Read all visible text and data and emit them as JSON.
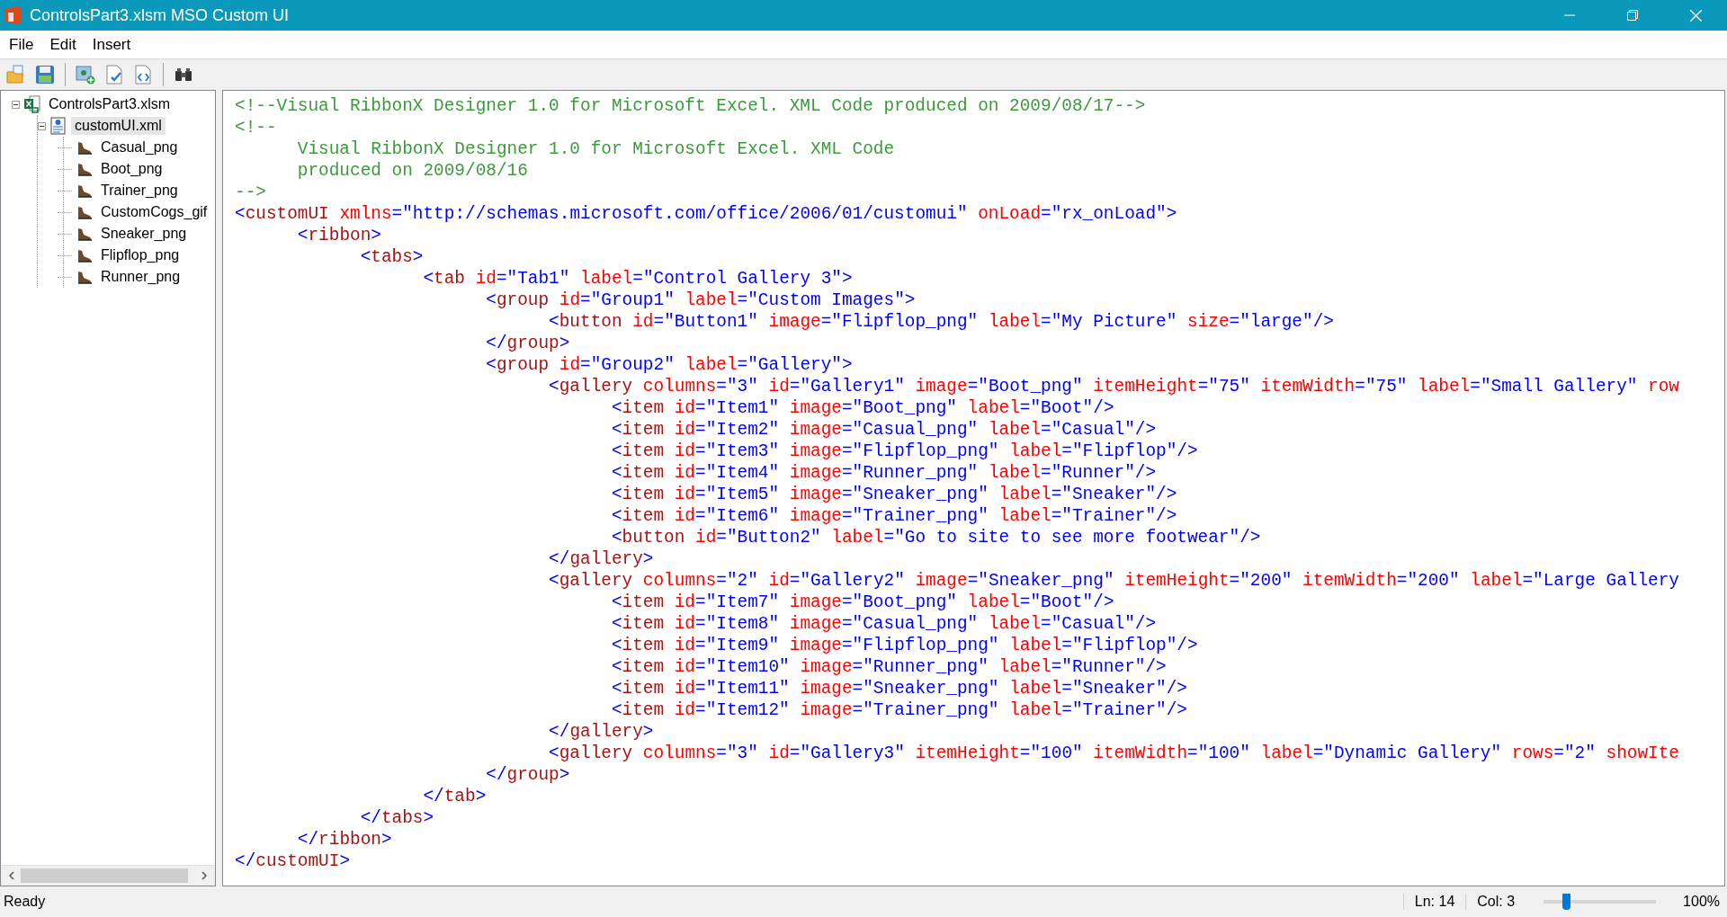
{
  "window": {
    "title": "ControlsPart3.xlsm MSO Custom UI"
  },
  "menu": [
    "File",
    "Edit",
    "Insert"
  ],
  "toolbar": [
    {
      "kind": "open"
    },
    {
      "kind": "save"
    },
    {
      "kind": "separator"
    },
    {
      "kind": "insert-image"
    },
    {
      "kind": "validate"
    },
    {
      "kind": "callbacks"
    },
    {
      "kind": "separator"
    },
    {
      "kind": "find"
    }
  ],
  "tree": [
    {
      "label": "ControlsPart3.xlsm",
      "kind": "workbook",
      "expanded": true,
      "selected": false,
      "children": [
        {
          "label": "customUI.xml",
          "kind": "xml",
          "expanded": true,
          "selected": true,
          "children": [
            {
              "label": "Casual_png",
              "kind": "image",
              "selected": false
            },
            {
              "label": "Boot_png",
              "kind": "image",
              "selected": false
            },
            {
              "label": "Trainer_png",
              "kind": "image",
              "selected": false
            },
            {
              "label": "CustomCogs_gif",
              "kind": "image",
              "selected": false
            },
            {
              "label": "Sneaker_png",
              "kind": "image",
              "selected": false
            },
            {
              "label": "Flipflop_png",
              "kind": "image",
              "selected": false
            },
            {
              "label": "Runner_png",
              "kind": "image",
              "selected": false
            }
          ]
        }
      ]
    }
  ],
  "code_lines": [
    {
      "kind": "comment",
      "text": "<!--Visual RibbonX Designer 1.0 for Microsoft Excel. XML Code produced on 2009/08/17-->"
    },
    {
      "kind": "comment",
      "text": "<!--"
    },
    {
      "kind": "comment",
      "text": "\tVisual RibbonX Designer 1.0 for Microsoft Excel. XML Code"
    },
    {
      "kind": "comment",
      "text": "\tproduced on 2009/08/16"
    },
    {
      "kind": "comment",
      "text": "-->"
    },
    {
      "kind": "markup",
      "text": "<customUI xmlns=\"http://schemas.microsoft.com/office/2006/01/customui\" onLoad=\"rx_onLoad\">"
    },
    {
      "kind": "markup",
      "text": "\t<ribbon>"
    },
    {
      "kind": "markup",
      "text": "\t\t<tabs>"
    },
    {
      "kind": "markup",
      "text": "\t\t\t<tab id=\"Tab1\" label=\"Control Gallery 3\">"
    },
    {
      "kind": "markup",
      "text": "\t\t\t\t<group id=\"Group1\" label=\"Custom Images\">"
    },
    {
      "kind": "markup",
      "text": "\t\t\t\t\t<button id=\"Button1\" image=\"Flipflop_png\" label=\"My Picture\" size=\"large\"/>"
    },
    {
      "kind": "markup",
      "text": "\t\t\t\t</group>"
    },
    {
      "kind": "markup",
      "text": "\t\t\t\t<group id=\"Group2\" label=\"Gallery\">"
    },
    {
      "kind": "markup",
      "text": "\t\t\t\t\t<gallery columns=\"3\" id=\"Gallery1\" image=\"Boot_png\" itemHeight=\"75\" itemWidth=\"75\" label=\"Small Gallery\" row"
    },
    {
      "kind": "markup",
      "text": "\t\t\t\t\t\t<item id=\"Item1\" image=\"Boot_png\" label=\"Boot\"/>"
    },
    {
      "kind": "markup",
      "text": "\t\t\t\t\t\t<item id=\"Item2\" image=\"Casual_png\" label=\"Casual\"/>"
    },
    {
      "kind": "markup",
      "text": "\t\t\t\t\t\t<item id=\"Item3\" image=\"Flipflop_png\" label=\"Flipflop\"/>"
    },
    {
      "kind": "markup",
      "text": "\t\t\t\t\t\t<item id=\"Item4\" image=\"Runner_png\" label=\"Runner\"/>"
    },
    {
      "kind": "markup",
      "text": "\t\t\t\t\t\t<item id=\"Item5\" image=\"Sneaker_png\" label=\"Sneaker\"/>"
    },
    {
      "kind": "markup",
      "text": "\t\t\t\t\t\t<item id=\"Item6\" image=\"Trainer_png\" label=\"Trainer\"/>"
    },
    {
      "kind": "markup",
      "text": "\t\t\t\t\t\t<button id=\"Button2\" label=\"Go to site to see more footwear\"/>"
    },
    {
      "kind": "markup",
      "text": "\t\t\t\t\t</gallery>"
    },
    {
      "kind": "markup",
      "text": "\t\t\t\t\t<gallery columns=\"2\" id=\"Gallery2\" image=\"Sneaker_png\" itemHeight=\"200\" itemWidth=\"200\" label=\"Large Gallery"
    },
    {
      "kind": "markup",
      "text": "\t\t\t\t\t\t<item id=\"Item7\" image=\"Boot_png\" label=\"Boot\"/>"
    },
    {
      "kind": "markup",
      "text": "\t\t\t\t\t\t<item id=\"Item8\" image=\"Casual_png\" label=\"Casual\"/>"
    },
    {
      "kind": "markup",
      "text": "\t\t\t\t\t\t<item id=\"Item9\" image=\"Flipflop_png\" label=\"Flipflop\"/>"
    },
    {
      "kind": "markup",
      "text": "\t\t\t\t\t\t<item id=\"Item10\" image=\"Runner_png\" label=\"Runner\"/>"
    },
    {
      "kind": "markup",
      "text": "\t\t\t\t\t\t<item id=\"Item11\" image=\"Sneaker_png\" label=\"Sneaker\"/>"
    },
    {
      "kind": "markup",
      "text": "\t\t\t\t\t\t<item id=\"Item12\" image=\"Trainer_png\" label=\"Trainer\"/>"
    },
    {
      "kind": "markup",
      "text": "\t\t\t\t\t</gallery>"
    },
    {
      "kind": "markup",
      "text": "\t\t\t\t\t<gallery columns=\"3\" id=\"Gallery3\" itemHeight=\"100\" itemWidth=\"100\" label=\"Dynamic Gallery\" rows=\"2\" showIte"
    },
    {
      "kind": "markup",
      "text": "\t\t\t\t</group>"
    },
    {
      "kind": "markup",
      "text": "\t\t\t</tab>"
    },
    {
      "kind": "markup",
      "text": "\t\t</tabs>"
    },
    {
      "kind": "markup",
      "text": "\t</ribbon>"
    },
    {
      "kind": "markup",
      "text": "</customUI>"
    }
  ],
  "status_bar": {
    "status": "Ready",
    "line": "Ln: 14",
    "column": "Col: 3",
    "zoom": {
      "level": 0.2,
      "reading": "100%"
    }
  }
}
